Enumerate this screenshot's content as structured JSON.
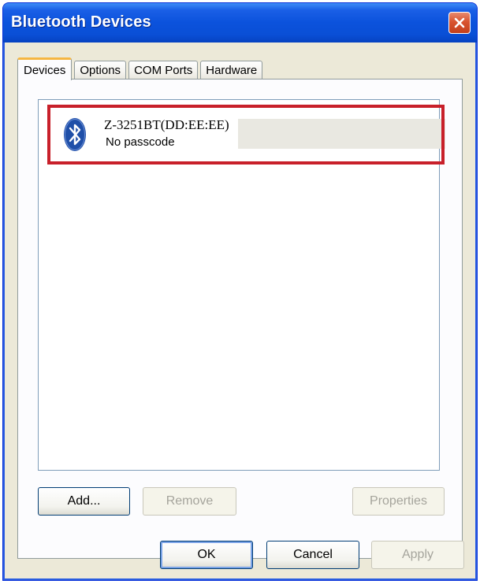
{
  "window": {
    "title": "Bluetooth Devices"
  },
  "tabs": [
    {
      "label": "Devices",
      "active": true
    },
    {
      "label": "Options",
      "active": false
    },
    {
      "label": "COM Ports",
      "active": false
    },
    {
      "label": "Hardware",
      "active": false
    }
  ],
  "devices": [
    {
      "name": "Z-3251BT(DD:EE:EE)",
      "status": "No passcode",
      "icon": "bluetooth-icon"
    }
  ],
  "panel_buttons": {
    "add": "Add...",
    "remove": "Remove",
    "properties": "Properties"
  },
  "dialog_buttons": {
    "ok": "OK",
    "cancel": "Cancel",
    "apply": "Apply"
  },
  "colors": {
    "titlebar": "#0b52dc",
    "highlight": "#c8202a",
    "bluetooth": "#1f4fa8",
    "active_tab_accent": "#f5b642"
  }
}
